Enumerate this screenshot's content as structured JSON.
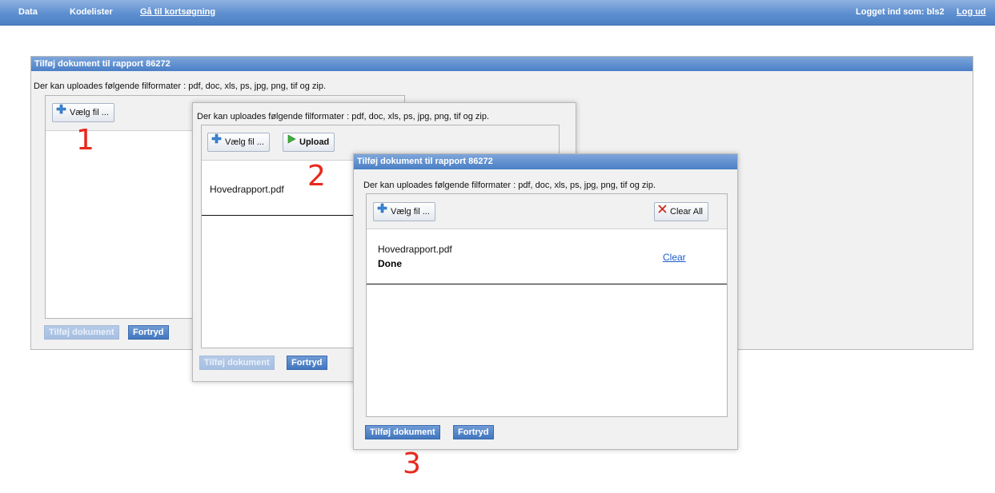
{
  "nav": {
    "data": "Data",
    "kodelister": "Kodelister",
    "quick_search": "Gå til kortsøgning",
    "logged_in": "Logget ind som: bls2",
    "logout": "Log ud"
  },
  "dialog1": {
    "title": "Tilføj dokument til rapport 86272",
    "formats": "Der kan uploades følgende filformater : pdf, doc, xls, ps, jpg, png, tif og zip.",
    "choose_file": "Vælg fil ...",
    "add_document": "Tilføj dokument",
    "cancel": "Fortryd"
  },
  "dialog2": {
    "formats": "Der kan uploades følgende filformater : pdf, doc, xls, ps, jpg, png, tif og zip.",
    "choose_file": "Vælg fil ...",
    "upload": "Upload",
    "file_name": "Hovedrapport.pdf",
    "add_document": "Tilføj dokument",
    "cancel": "Fortryd"
  },
  "dialog3": {
    "title": "Tilføj dokument til rapport 86272",
    "formats": "Der kan uploades følgende filformater : pdf, doc, xls, ps, jpg, png, tif og zip.",
    "choose_file": "Vælg fil ...",
    "clear_all": "Clear All",
    "file_name": "Hovedrapport.pdf",
    "file_status": "Done",
    "clear": "Clear",
    "add_document": "Tilføj dokument",
    "cancel": "Fortryd"
  },
  "steps": [
    "1",
    "2",
    "3"
  ],
  "icons": {
    "add": "plus-icon",
    "upload": "play-arrow-icon",
    "clear_all": "x-icon"
  },
  "colors": {
    "nav_bar": "#5d8fd0",
    "title_bar": "#4a7fc7",
    "step_number": "#e8281c",
    "link": "#1a5ccc"
  }
}
